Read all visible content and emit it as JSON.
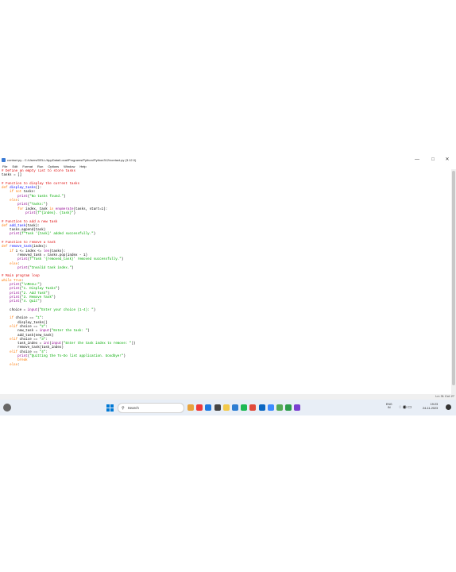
{
  "window": {
    "title": "contact.py - C:/Users/DELL/AppData/Local/Programs/Python/Python312/contact.py (3.12.0)",
    "controls": [
      "—",
      "□",
      "✕"
    ]
  },
  "menu": [
    "File",
    "Edit",
    "Format",
    "Run",
    "Options",
    "Window",
    "Help"
  ],
  "status": {
    "position": "Ln: 31   Col: 27"
  },
  "taskbar": {
    "search_label": "Search",
    "lang_line1": "ENG",
    "lang_line2": "IN",
    "time": "19:23",
    "date": "24-11-2023",
    "app_colors": [
      "#e8a33d",
      "#ef3a3a",
      "#1f7ae0",
      "#444444",
      "#f2c94c",
      "#2d7dd2",
      "#1db954",
      "#e04a3b",
      "#0a66c2",
      "#3d8bff",
      "#55aa55",
      "#2d9c4b",
      "#7a3fd0"
    ]
  },
  "code_lines": [
    [
      [
        "cm",
        "# Define an empty list to store tasks"
      ]
    ],
    [
      [
        "",
        "tasks = []"
      ]
    ],
    [],
    [
      [
        "cm",
        "# Function to display the current tasks"
      ]
    ],
    [
      [
        "kw",
        "def "
      ],
      [
        "fn",
        "display_tasks"
      ],
      [
        "",
        "():"
      ]
    ],
    [
      [
        "",
        "    "
      ],
      [
        "kw",
        "if not "
      ],
      [
        "",
        "tasks:"
      ]
    ],
    [
      [
        "",
        "        "
      ],
      [
        "bi",
        "print"
      ],
      [
        "",
        "("
      ],
      [
        "str",
        "\"No tasks found.\""
      ],
      [
        "",
        ")"
      ]
    ],
    [
      [
        "",
        "    "
      ],
      [
        "kw",
        "else"
      ],
      [
        "",
        ":"
      ]
    ],
    [
      [
        "",
        "        "
      ],
      [
        "bi",
        "print"
      ],
      [
        "",
        "("
      ],
      [
        "str",
        "\"Tasks:\""
      ],
      [
        "",
        ")"
      ]
    ],
    [
      [
        "",
        "        "
      ],
      [
        "kw",
        "for "
      ],
      [
        "",
        "index, task "
      ],
      [
        "kw",
        "in "
      ],
      [
        "bi",
        "enumerate"
      ],
      [
        "",
        "(tasks, start=1):"
      ]
    ],
    [
      [
        "",
        "            "
      ],
      [
        "bi",
        "print"
      ],
      [
        "",
        "("
      ],
      [
        "str",
        "f\"{index}. {task}\""
      ],
      [
        "",
        ")"
      ]
    ],
    [],
    [
      [
        "cm",
        "# Function to add a new task"
      ]
    ],
    [
      [
        "kw",
        "def "
      ],
      [
        "fn",
        "add_task"
      ],
      [
        "",
        "(task):"
      ]
    ],
    [
      [
        "",
        "    tasks.append(task)"
      ]
    ],
    [
      [
        "",
        "    "
      ],
      [
        "bi",
        "print"
      ],
      [
        "",
        "("
      ],
      [
        "str",
        "f\"Task '{task}' added successfully.\""
      ],
      [
        "",
        ")"
      ]
    ],
    [],
    [
      [
        "cm",
        "# Function to remove a task"
      ]
    ],
    [
      [
        "kw",
        "def "
      ],
      [
        "fn",
        "remove_task"
      ],
      [
        "",
        "(index):"
      ]
    ],
    [
      [
        "",
        "    "
      ],
      [
        "kw",
        "if "
      ],
      [
        "",
        "1 <= index <= "
      ],
      [
        "bi",
        "len"
      ],
      [
        "",
        "(tasks):"
      ]
    ],
    [
      [
        "",
        "        removed_task = tasks.pop(index - 1)"
      ]
    ],
    [
      [
        "",
        "        "
      ],
      [
        "bi",
        "print"
      ],
      [
        "",
        "("
      ],
      [
        "str",
        "f\"Task '{removed_task}' removed successfully.\""
      ],
      [
        "",
        ")"
      ]
    ],
    [
      [
        "",
        "    "
      ],
      [
        "kw",
        "else"
      ],
      [
        "",
        ":"
      ]
    ],
    [
      [
        "",
        "        "
      ],
      [
        "bi",
        "print"
      ],
      [
        "",
        "("
      ],
      [
        "str",
        "\"Invalid task index.\""
      ],
      [
        "",
        ")"
      ]
    ],
    [],
    [
      [
        "cm",
        "# Main program loop"
      ]
    ],
    [
      [
        "kw",
        "while "
      ],
      [
        "kw",
        "True"
      ],
      [
        "",
        ":"
      ]
    ],
    [
      [
        "",
        "    "
      ],
      [
        "bi",
        "print"
      ],
      [
        "",
        "("
      ],
      [
        "str",
        "\"\\nMenu:\""
      ],
      [
        "",
        ")"
      ]
    ],
    [
      [
        "",
        "    "
      ],
      [
        "bi",
        "print"
      ],
      [
        "",
        "("
      ],
      [
        "str",
        "\"1. Display Tasks\""
      ],
      [
        "",
        ")"
      ]
    ],
    [
      [
        "",
        "    "
      ],
      [
        "bi",
        "print"
      ],
      [
        "",
        "("
      ],
      [
        "str",
        "\"2. Add Task\""
      ],
      [
        "",
        ")"
      ]
    ],
    [
      [
        "",
        "    "
      ],
      [
        "bi",
        "print"
      ],
      [
        "",
        "("
      ],
      [
        "str",
        "\"3. Remove Task\""
      ],
      [
        "",
        ")"
      ]
    ],
    [
      [
        "",
        "    "
      ],
      [
        "bi",
        "print"
      ],
      [
        "",
        "("
      ],
      [
        "str",
        "\"4. Quit\""
      ],
      [
        "",
        ")"
      ]
    ],
    [],
    [
      [
        "",
        "    choice = "
      ],
      [
        "bi",
        "input"
      ],
      [
        "",
        "("
      ],
      [
        "str",
        "\"Enter your choice (1-4): \""
      ],
      [
        "",
        ")"
      ]
    ],
    [],
    [
      [
        "",
        "    "
      ],
      [
        "kw",
        "if "
      ],
      [
        "",
        "choice == "
      ],
      [
        "str",
        "\"1\""
      ],
      [
        "",
        ":"
      ]
    ],
    [
      [
        "",
        "        display_tasks()"
      ]
    ],
    [
      [
        "",
        "    "
      ],
      [
        "kw",
        "elif "
      ],
      [
        "",
        "choice == "
      ],
      [
        "str",
        "\"2\""
      ],
      [
        "",
        ":"
      ]
    ],
    [
      [
        "",
        "        new_task = "
      ],
      [
        "bi",
        "input"
      ],
      [
        "",
        "("
      ],
      [
        "str",
        "\"Enter the task: \""
      ],
      [
        "",
        ")"
      ]
    ],
    [
      [
        "",
        "        add_task(new_task)"
      ]
    ],
    [
      [
        "",
        "    "
      ],
      [
        "kw",
        "elif "
      ],
      [
        "",
        "choice == "
      ],
      [
        "str",
        "\"3\""
      ],
      [
        "",
        ":"
      ]
    ],
    [
      [
        "",
        "        task_index = "
      ],
      [
        "bi",
        "int"
      ],
      [
        "",
        "("
      ],
      [
        "bi",
        "input"
      ],
      [
        "",
        "("
      ],
      [
        "str",
        "\"Enter the task index to remove: \""
      ],
      [
        "",
        "))"
      ]
    ],
    [
      [
        "",
        "        remove_task(task_index)"
      ]
    ],
    [
      [
        "",
        "    "
      ],
      [
        "kw",
        "elif "
      ],
      [
        "",
        "choice == "
      ],
      [
        "str",
        "\"4\""
      ],
      [
        "",
        ":"
      ]
    ],
    [
      [
        "",
        "        "
      ],
      [
        "bi",
        "print"
      ],
      [
        "",
        "("
      ],
      [
        "str",
        "\"Quitting the To-Do list application. Goodbye!\""
      ],
      [
        "",
        ")"
      ]
    ],
    [
      [
        "",
        "        "
      ],
      [
        "kw",
        "break"
      ]
    ],
    [
      [
        "",
        "    "
      ],
      [
        "kw",
        "else"
      ],
      [
        "",
        ":"
      ]
    ]
  ]
}
